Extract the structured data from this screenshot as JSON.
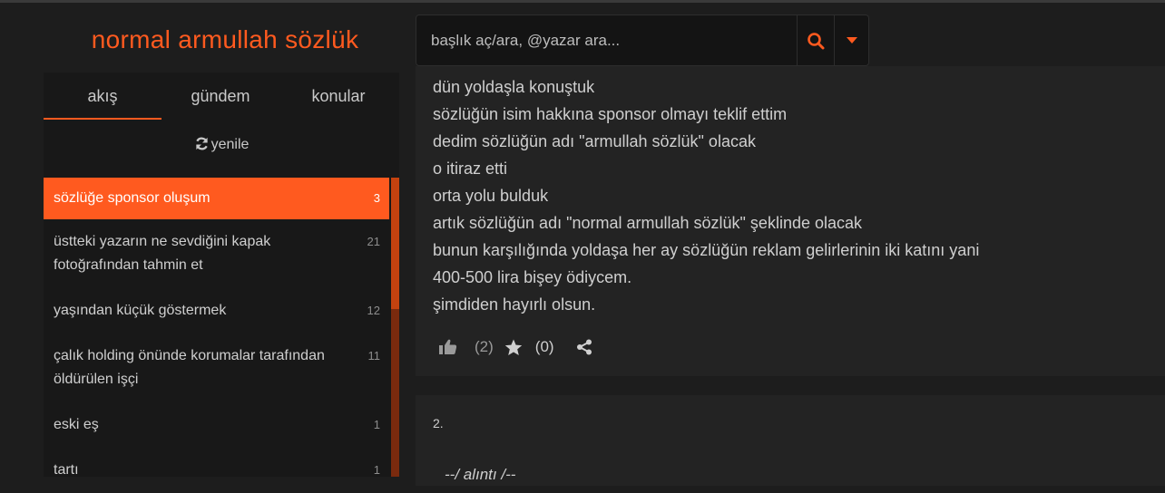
{
  "logo": {
    "text": "normal armullah sözlük"
  },
  "search": {
    "placeholder": "başlık aç/ara, @yazar ara...",
    "value": "",
    "button_icon": "search-icon",
    "menu_icon": "caret-down-icon"
  },
  "tabs": [
    {
      "label": "akış",
      "active": true
    },
    {
      "label": "gündem",
      "active": false
    },
    {
      "label": "konular",
      "active": false
    }
  ],
  "refresh": {
    "label": "yenile",
    "icon": "refresh-icon"
  },
  "topics": [
    {
      "title": "sözlüğe sponsor oluşum",
      "count": "3",
      "active": true
    },
    {
      "title": "üstteki yazarın ne sevdiğini kapak fotoğrafından tahmin et",
      "count": "21",
      "active": false
    },
    {
      "title": "yaşından küçük göstermek",
      "count": "12",
      "active": false
    },
    {
      "title": "çalık holding önünde korumalar tarafından öldürülen işçi",
      "count": "11",
      "active": false
    },
    {
      "title": "eski eş",
      "count": "1",
      "active": false
    },
    {
      "title": "tartı",
      "count": "1",
      "active": false
    }
  ],
  "entry": {
    "text": "dün yoldaşla konuştuk\nsözlüğün isim hakkına sponsor olmayı teklif ettim\ndedim sözlüğün adı \"armullah sözlük\" olacak\no itiraz etti\norta yolu bulduk\nartık sözlüğün adı \"normal armullah sözlük\" şeklinde olacak\nbunun karşılığında yoldaşa her ay sözlüğün reklam gelirlerinin iki katını yani\n400-500 lira bişey ödiycem.\nşimdiden hayırlı olsun.",
    "like_count": "(2)",
    "fav_count": "(0)",
    "icons": {
      "like": "thumbs-up-icon",
      "favorite": "star-icon",
      "share": "share-icon"
    }
  },
  "entry2": {
    "number": "2.",
    "quote_partial": "--/ alıntı /--"
  },
  "colors": {
    "accent": "#ff5a1f",
    "background": "#1d1d1d",
    "card": "#232323",
    "panel": "#181818"
  }
}
